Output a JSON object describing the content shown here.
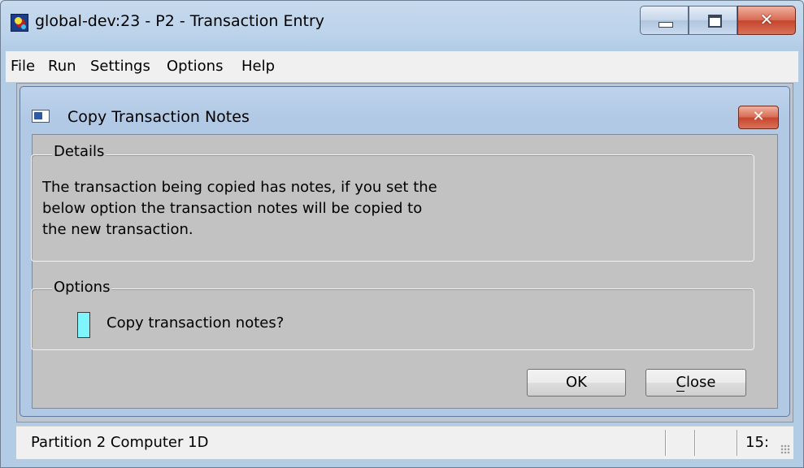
{
  "window": {
    "title": "global-dev:23 - P2 - Transaction Entry",
    "icon": "app-icon",
    "controls": [
      "minimize-icon",
      "maximize-icon",
      "close-icon"
    ]
  },
  "menu": {
    "items": [
      "File",
      "Run",
      "Settings",
      "Options",
      "Help"
    ]
  },
  "dialog": {
    "title": "Copy Transaction Notes",
    "close_glyph": "✕",
    "details": {
      "legend": "Details",
      "lines": [
        "The transaction being copied has notes, if you set the",
        "below option the transaction notes will be copied to",
        "the new transaction."
      ]
    },
    "options": {
      "legend": "Options",
      "checkbox_label": "Copy transaction notes?",
      "checkbox_checked": false,
      "checkbox_color": "#7ff6ff"
    },
    "buttons": {
      "ok": "OK",
      "close": "Close"
    }
  },
  "statusbar": {
    "text": "Partition 2 Computer 1D",
    "time": "15:"
  },
  "colors": {
    "dialog_bg": "#c2c2c2",
    "close_red": "#c5452a",
    "title_blue": "#bed3eb"
  }
}
